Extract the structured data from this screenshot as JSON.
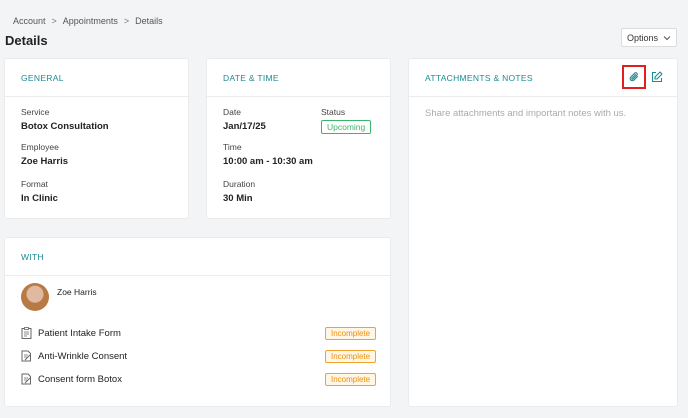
{
  "breadcrumb": [
    "Account",
    "Appointments",
    "Details"
  ],
  "breadcrumb_sep": ">",
  "page_title": "Details",
  "options": {
    "label": "Options"
  },
  "general": {
    "title": "GENERAL",
    "service_label": "Service",
    "service_value": "Botox Consultation",
    "employee_label": "Employee",
    "employee_value": "Zoe Harris",
    "format_label": "Format",
    "format_value": "In Clinic"
  },
  "datetime": {
    "title": "DATE & TIME",
    "date_label": "Date",
    "date_value": "Jan/17/25",
    "status_label": "Status",
    "status_value": "Upcoming",
    "time_label": "Time",
    "time_value": "10:00 am - 10:30 am",
    "duration_label": "Duration",
    "duration_value": "30 Min"
  },
  "attachments": {
    "title": "ATTACHMENTS & NOTES",
    "placeholder": "Share attachments and important notes with us.",
    "icons": [
      "paperclip-icon",
      "edit-icon"
    ]
  },
  "with": {
    "title": "WITH",
    "person": "Zoe Harris",
    "forms": [
      {
        "name": "Patient Intake Form",
        "status": "Incomplete"
      },
      {
        "name": "Anti-Wrinkle Consent",
        "status": "Incomplete"
      },
      {
        "name": "Consent form Botox",
        "status": "Incomplete"
      }
    ]
  },
  "colors": {
    "accent": "#1b8b94",
    "upcoming": "#3ab56b",
    "incomplete": "#f0a22c",
    "highlight": "#e02020"
  }
}
